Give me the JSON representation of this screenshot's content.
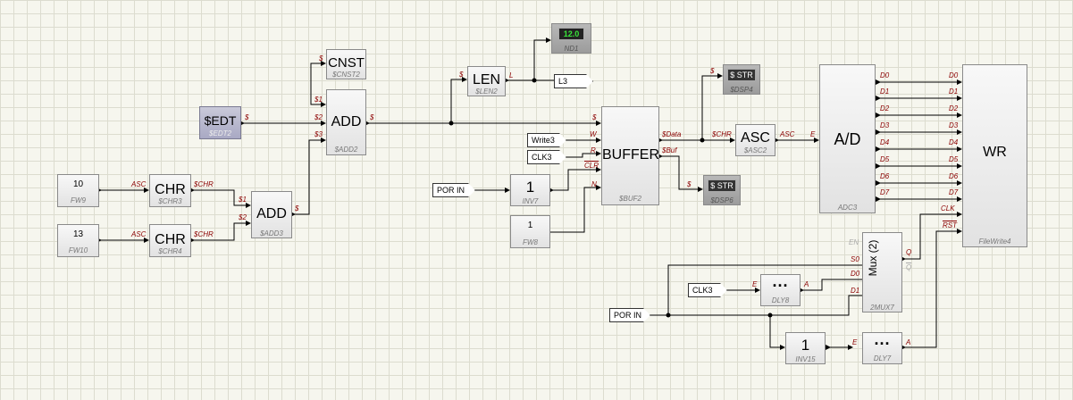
{
  "blocks": {
    "fw9": {
      "value": "10",
      "caption": "FW9"
    },
    "fw10": {
      "value": "13",
      "caption": "FW10"
    },
    "chr3": {
      "label": "CHR",
      "caption": "$CHR3",
      "in": "ASC",
      "out": "$CHR"
    },
    "chr4": {
      "label": "CHR",
      "caption": "$CHR4",
      "in": "ASC",
      "out": "$CHR"
    },
    "add3": {
      "label": "ADD",
      "caption": "$ADD3",
      "in1": "$1",
      "in2": "$2",
      "out": "$"
    },
    "edt2": {
      "label": "$EDT",
      "caption": "$EDT2",
      "out": "$"
    },
    "cnst2": {
      "label": "CNST",
      "caption": "$CNST2",
      "out": "$"
    },
    "add2": {
      "label": "ADD",
      "caption": "$ADD2",
      "in1": "$1",
      "in2": "$2",
      "in3": "$3",
      "out": "$"
    },
    "len2": {
      "label": "LEN",
      "caption": "$LEN2",
      "in": "$",
      "out": "L"
    },
    "nd1": {
      "value": "12.0",
      "caption": "ND1"
    },
    "l3": {
      "label": "L3"
    },
    "buf2": {
      "label": "BUFFER",
      "caption": "$BUF2",
      "in_s": "$",
      "in_w": "W",
      "in_r": "R",
      "in_clr": "CLR",
      "in_n": "N",
      "out_data": "$Data",
      "out_buf": "$Buf"
    },
    "write3": {
      "label": "Write3"
    },
    "clk3a": {
      "label": "CLK3"
    },
    "porin1": {
      "label": "POR IN"
    },
    "inv7": {
      "label": "1",
      "caption": "INV7"
    },
    "fw8": {
      "value": "1",
      "caption": "FW8"
    },
    "dsp4": {
      "value": "$ STR",
      "caption": "$DSP4",
      "in": "$"
    },
    "dsp6": {
      "value": "$ STR",
      "caption": "$DSP6",
      "in": "$"
    },
    "asc2": {
      "label": "ASC",
      "caption": "$ASC2",
      "in": "$CHR",
      "out": "ASC"
    },
    "adc3": {
      "label": "A/D",
      "caption": "ADC3",
      "in": "E",
      "outs": [
        "D0",
        "D1",
        "D2",
        "D3",
        "D4",
        "D5",
        "D6",
        "D7"
      ]
    },
    "wr": {
      "label": "WR",
      "caption": "FileWrite4",
      "ins": [
        "D0",
        "D1",
        "D2",
        "D3",
        "D4",
        "D5",
        "D6",
        "D7"
      ],
      "clk": "CLK",
      "rst": "RST"
    },
    "mux7": {
      "label": "Mux (2)",
      "caption": "2MUX7",
      "en": "EN",
      "s0": "S0",
      "d0": "D0",
      "d1": "D1",
      "q": "Q",
      "qn": "Q"
    },
    "clk3b": {
      "label": "CLK3"
    },
    "dly8": {
      "label": "···",
      "caption": "DLY8",
      "in": "E",
      "out": "A"
    },
    "porin2": {
      "label": "POR IN"
    },
    "inv15": {
      "label": "1",
      "caption": "INV15"
    },
    "dly7": {
      "label": "···",
      "caption": "DLY7",
      "in": "E",
      "out": "A"
    }
  }
}
